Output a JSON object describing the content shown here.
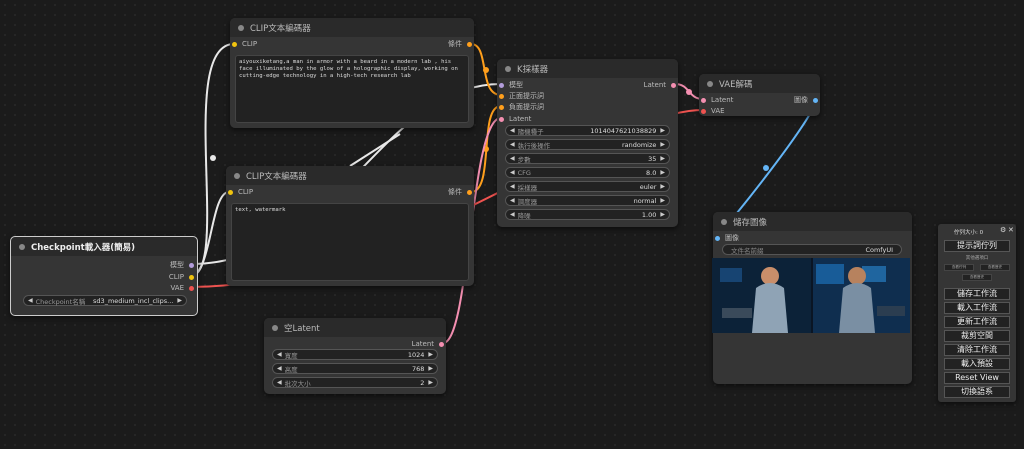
{
  "colors": {
    "clip": "#f1c40f",
    "model": "#b39ddb",
    "conditioning": "#ff9f1c",
    "latent": "#f48fb1",
    "vae": "#ef5350",
    "image": "#64b5f6",
    "wire_clip": "#e8e8e8"
  },
  "clip_node_1": {
    "title": "CLIP文本編碼器",
    "input_label": "CLIP",
    "output_label": "條件",
    "text": "aiyouxiketang,a man in armor with a beard in a modern lab , his face illuminated by the glow of a holographic display, working on cutting-edge technology in a high-tech research lab"
  },
  "clip_node_2": {
    "title": "CLIP文本編碼器",
    "input_label": "CLIP",
    "output_label": "條件",
    "text": "text, watermark"
  },
  "checkpoint_node": {
    "title": "Checkpoint載入器(簡易)",
    "outputs": [
      "模型",
      "CLIP",
      "VAE"
    ],
    "widget_label": "Checkpoint名稱",
    "widget_value": "sd3_medium_incl_clips..."
  },
  "ksampler_node": {
    "title": "K採樣器",
    "inputs": [
      "模型",
      "正面提示詞",
      "負面提示詞",
      "Latent"
    ],
    "output_label": "Latent",
    "widgets": [
      {
        "label": "隨機種子",
        "value": "1014047621038829"
      },
      {
        "label": "執行後操作",
        "value": "randomize"
      },
      {
        "label": "步數",
        "value": "35"
      },
      {
        "label": "CFG",
        "value": "8.0"
      },
      {
        "label": "採樣器",
        "value": "euler"
      },
      {
        "label": "調度器",
        "value": "normal"
      },
      {
        "label": "降噪",
        "value": "1.00"
      }
    ]
  },
  "vae_node": {
    "title": "VAE解碼",
    "inputs": [
      "Latent",
      "VAE"
    ],
    "output_label": "圖像"
  },
  "latent_node": {
    "title": "空Latent",
    "output_label": "Latent",
    "widgets": [
      {
        "label": "寬度",
        "value": "1024"
      },
      {
        "label": "高度",
        "value": "768"
      },
      {
        "label": "批次大小",
        "value": "2"
      }
    ]
  },
  "save_node": {
    "title": "儲存圖像",
    "input_label": "圖像",
    "filename_label": "文件名前綴",
    "filename_value": "ComfyUI"
  },
  "menu": {
    "queue_label": "佇列大小: 0",
    "gear_icon": "gear-icon",
    "close_icon": "close-icon",
    "queue_prompt": "提示詞佇列",
    "extra_options": "其他選項口",
    "small_btn_1": "查看佇列",
    "small_btn_2": "查看歷史",
    "small_btn_3": "查看歷史",
    "buttons": [
      "儲存工作流",
      "載入工作流",
      "更新工作流",
      "裁剪空間",
      "清除工作流",
      "載入預設",
      "Reset View",
      "切換語系"
    ]
  }
}
